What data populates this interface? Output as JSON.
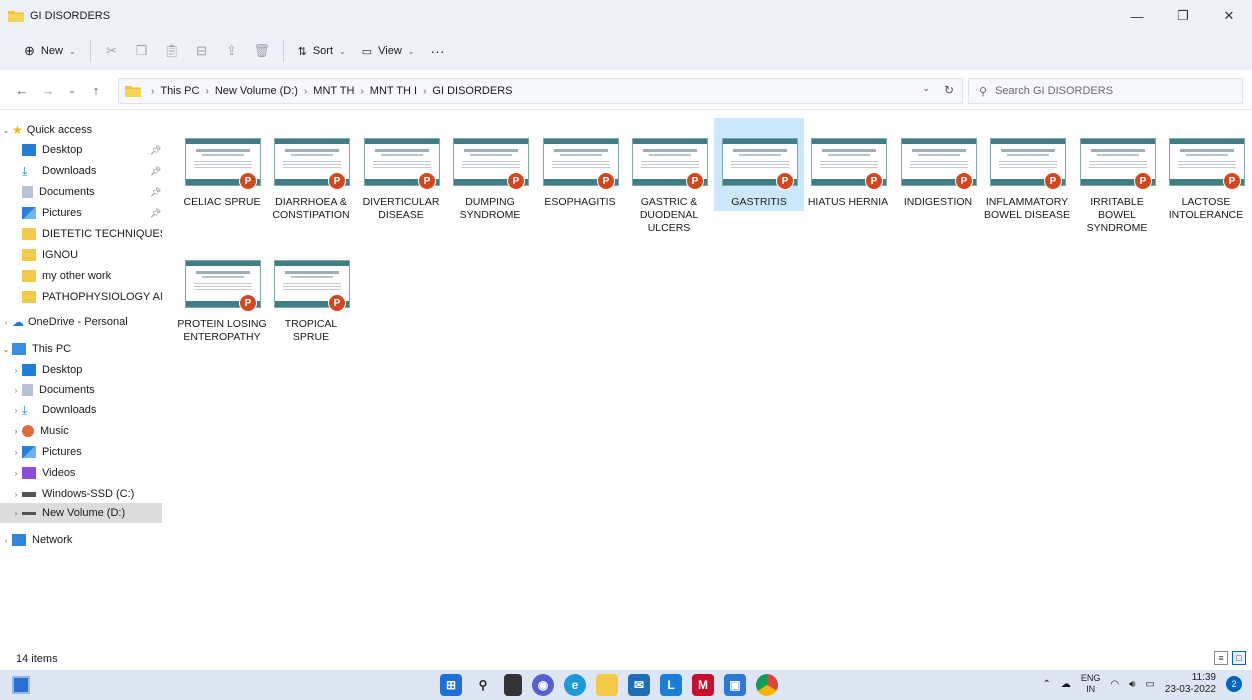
{
  "window": {
    "title": "GI DISORDERS",
    "minimize": "—",
    "maximize": "❐",
    "close": "✕"
  },
  "toolbar": {
    "new_label": "New",
    "sort_label": "Sort",
    "view_label": "View",
    "more_label": "···"
  },
  "address": {
    "crumbs": [
      "This PC",
      "New Volume (D:)",
      "MNT TH",
      "MNT TH I",
      "GI DISORDERS"
    ],
    "search_placeholder": "Search GI DISORDERS"
  },
  "sidebar": {
    "quick_access": "Quick access",
    "quick_items": [
      "Desktop",
      "Downloads",
      "Documents",
      "Pictures",
      "DIETETIC TECHNIQUES AN",
      "IGNOU",
      "my other work",
      "PATHOPHYSIOLOGY AND I"
    ],
    "onedrive": "OneDrive - Personal",
    "this_pc": "This PC",
    "pc_items": [
      "Desktop",
      "Documents",
      "Downloads",
      "Music",
      "Pictures",
      "Videos",
      "Windows-SSD (C:)",
      "New Volume (D:)"
    ],
    "network": "Network"
  },
  "files": [
    {
      "line1": "CELIAC SPRUE",
      "line2": "",
      "line3": ""
    },
    {
      "line1": "DIARRHOEA &",
      "line2": "CONSTIPATION",
      "line3": ""
    },
    {
      "line1": "DIVERTICULAR",
      "line2": "DISEASE",
      "line3": ""
    },
    {
      "line1": "DUMPING",
      "line2": "SYNDROME",
      "line3": ""
    },
    {
      "line1": "ESOPHAGITIS",
      "line2": "",
      "line3": ""
    },
    {
      "line1": "GASTRIC &",
      "line2": "DUODENAL",
      "line3": "ULCERS"
    },
    {
      "line1": "GASTRITIS",
      "line2": "",
      "line3": ""
    },
    {
      "line1": "HIATUS HERNIA",
      "line2": "",
      "line3": ""
    },
    {
      "line1": "INDIGESTION",
      "line2": "",
      "line3": ""
    },
    {
      "line1": "INFLAMMATORY",
      "line2": "BOWEL DISEASE",
      "line3": ""
    },
    {
      "line1": "IRRITABLE",
      "line2": "BOWEL",
      "line3": "SYNDROME"
    },
    {
      "line1": "LACTOSE",
      "line2": "INTOLERANCE",
      "line3": ""
    },
    {
      "line1": "PROTEIN LOSING",
      "line2": "ENTEROPATHY",
      "line3": ""
    },
    {
      "line1": "TROPICAL SPRUE",
      "line2": "",
      "line3": ""
    }
  ],
  "status": {
    "item_count": "14 items"
  },
  "taskbar": {
    "lang_top": "ENG",
    "lang_bottom": "IN",
    "time": "11:39",
    "date": "23-03-2022",
    "notifications": "2"
  }
}
